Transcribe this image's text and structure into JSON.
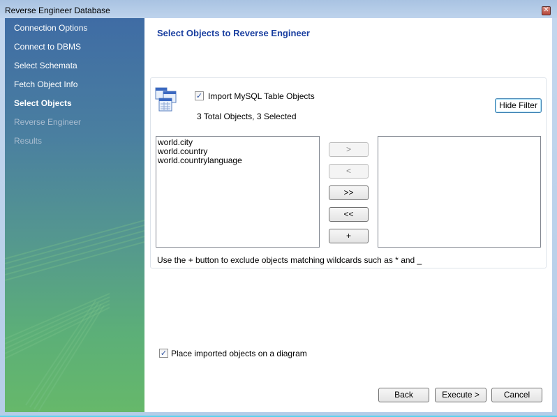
{
  "window": {
    "title": "Reverse Engineer Database",
    "close_icon": "close-icon"
  },
  "sidebar": {
    "items": [
      {
        "label": "Connection Options",
        "state": "done"
      },
      {
        "label": "Connect to DBMS",
        "state": "done"
      },
      {
        "label": "Select Schemata",
        "state": "done"
      },
      {
        "label": "Fetch Object Info",
        "state": "done"
      },
      {
        "label": "Select Objects",
        "state": "active"
      },
      {
        "label": "Reverse Engineer",
        "state": "disabled"
      },
      {
        "label": "Results",
        "state": "disabled"
      }
    ]
  },
  "main": {
    "title": "Select Objects to Reverse Engineer",
    "group": {
      "icon": "table-objects-icon",
      "import_checkbox": {
        "label": "Import MySQL Table Objects",
        "checked": true
      },
      "summary": "3 Total Objects, 3 Selected",
      "hide_filter_label": "Hide Filter",
      "available_list": [
        "world.city",
        "world.country",
        "world.countrylanguage"
      ],
      "excluded_list": [],
      "move_buttons": {
        "add": ">",
        "remove": "<",
        "add_all": ">>",
        "remove_all": "<<",
        "add_wildcard": "+"
      },
      "hint": "Use the + button to exclude objects matching wildcards such as * and _"
    },
    "diagram_checkbox": {
      "label": "Place imported objects on a diagram",
      "checked": true
    }
  },
  "footer": {
    "back_label": "Back",
    "execute_label": "Execute >",
    "cancel_label": "Cancel"
  }
}
